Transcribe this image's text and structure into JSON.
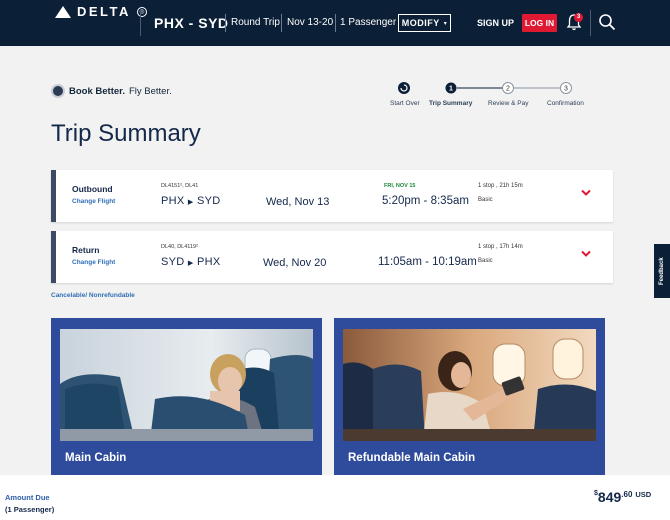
{
  "header": {
    "brand": "DELTA",
    "route": "PHX - SYD",
    "trip_type": "Round Trip",
    "dates": "Nov 13-20",
    "passengers": "1 Passenger",
    "modify_label": "MODIFY",
    "signup_label": "SIGN UP",
    "login_label": "LOG IN",
    "notification_count": "3"
  },
  "promo": {
    "lead": "Book Better.",
    "tail": " Fly Better."
  },
  "progress": {
    "steps": [
      {
        "label": "Start Over",
        "number": ""
      },
      {
        "label": "Trip Summary",
        "number": "1"
      },
      {
        "label": "Review & Pay",
        "number": "2"
      },
      {
        "label": "Confirmation",
        "number": "3"
      }
    ]
  },
  "page_title": "Trip Summary",
  "flights": [
    {
      "direction": "Outbound",
      "change_label": "Change Flight",
      "flight_numbers": "DL4151², DL41",
      "route_from": "PHX",
      "route_to": "SYD",
      "date": "Wed, Nov 13",
      "next_day": "FRI, NOV 15",
      "times": "5:20pm - 8:35am",
      "stops": "1 stop , 21h 15m",
      "fare": "Basic"
    },
    {
      "direction": "Return",
      "change_label": "Change Flight",
      "flight_numbers": "DL40, DL4119²",
      "route_from": "SYD",
      "route_to": "PHX",
      "date": "Wed, Nov 20",
      "next_day": "",
      "times": "11:05am - 10:19am",
      "stops": "1 stop , 17h 14m",
      "fare": "Basic"
    }
  ],
  "cancel_policy": "Cancelable/ Nonrefundable",
  "cabins": [
    {
      "name": "Main Cabin"
    },
    {
      "name": "Refundable Main Cabin"
    }
  ],
  "feedback_label": "Feedback",
  "footer": {
    "amount_label": "Amount Due",
    "amount_sub": "(1 Passenger)",
    "currency_symbol": "$",
    "amount_whole": "849",
    "amount_cents": ".60",
    "currency": "USD"
  },
  "colors": {
    "header_bg": "#0b1f36",
    "accent_red": "#e01933",
    "cabin_blue": "#2f4c9c",
    "link_blue": "#2f6fb8",
    "next_day_green": "#1a8a3a"
  }
}
